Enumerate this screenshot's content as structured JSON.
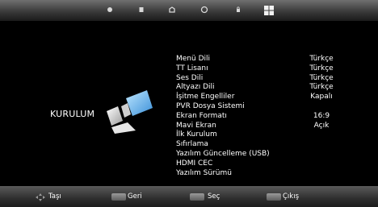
{
  "topbar": {
    "tabs": [
      {
        "icon": "picture-icon"
      },
      {
        "icon": "sound-icon"
      },
      {
        "icon": "home-icon"
      },
      {
        "icon": "clock-icon"
      },
      {
        "icon": "lock-icon"
      },
      {
        "icon": "setup-icon",
        "selected": true
      }
    ]
  },
  "section": {
    "label": "KURULUM"
  },
  "menu": {
    "items": [
      {
        "label": "Menü Dili",
        "value": "Türkçe"
      },
      {
        "label": "TT Lisanı",
        "value": "Türkçe"
      },
      {
        "label": "Ses Dili",
        "value": "Türkçe"
      },
      {
        "label": "Altyazı Dili",
        "value": "Türkçe"
      },
      {
        "label": "İşitme Engelliler",
        "value": "Kapalı"
      },
      {
        "label": "PVR Dosya Sistemi",
        "value": ""
      },
      {
        "label": "Ekran Formatı",
        "value": "16:9"
      },
      {
        "label": "Mavi Ekran",
        "value": "Açık"
      },
      {
        "label": "İlk Kurulum",
        "value": ""
      },
      {
        "label": "Sıfırlama",
        "value": ""
      },
      {
        "label": "Yazılım Güncelleme (USB)",
        "value": ""
      },
      {
        "label": "HDMI CEC",
        "value": ""
      },
      {
        "label": "Yazılım Sürümü",
        "value": ""
      }
    ]
  },
  "footer": {
    "move_label": "Taşı",
    "back_label": "Geri",
    "select_label": "Seç",
    "exit_label": "Çıkış"
  }
}
